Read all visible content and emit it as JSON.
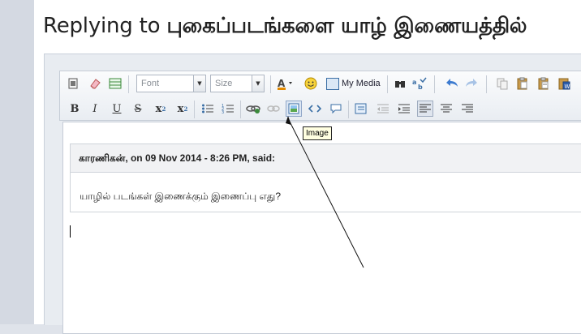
{
  "page": {
    "title_prefix": "Replying to",
    "post_title": "புகைப்படங்களை யாழ் இணையத்தில்"
  },
  "toolbar": {
    "font_combo": "Font",
    "size_combo": "Size",
    "my_media": "My Media",
    "icons_row1": [
      "source-icon",
      "remove-format-icon",
      "table-icon",
      "font-color-icon",
      "emoticon-icon",
      "my-media-icon",
      "find-icon",
      "spellcheck-icon",
      "undo-icon",
      "redo-icon",
      "copy-icon",
      "paste-icon",
      "paste-text-icon",
      "paste-word-icon"
    ],
    "icons_row2": [
      "bold-icon",
      "italic-icon",
      "underline-icon",
      "strikethrough-icon",
      "subscript-icon",
      "superscript-icon",
      "bulleted-list-icon",
      "numbered-list-icon",
      "link-icon",
      "unlink-icon",
      "image-icon",
      "code-icon",
      "speech-bubble-icon",
      "quote-icon",
      "outdent-icon",
      "indent-icon",
      "align-left-icon",
      "align-center-icon",
      "align-right-icon"
    ],
    "labels": {
      "bold": "B",
      "italic": "I",
      "underline": "U",
      "strike": "S",
      "sub": "x",
      "sup": "x",
      "sub_mark": "2",
      "sup_mark": "2"
    }
  },
  "tooltip": "Image",
  "editor": {
    "quote_author": "காரணிகன்",
    "quote_meta": ", on 09 Nov 2014 - 8:26 PM, said:",
    "quote_text": "யாழில் படங்கள் இணைக்கும் இணைப்பு எது?"
  },
  "colors": {
    "accent": "#3a6ea5",
    "toolbar_border": "#c5ccd6",
    "tooltip_bg": "#ffffe1"
  }
}
